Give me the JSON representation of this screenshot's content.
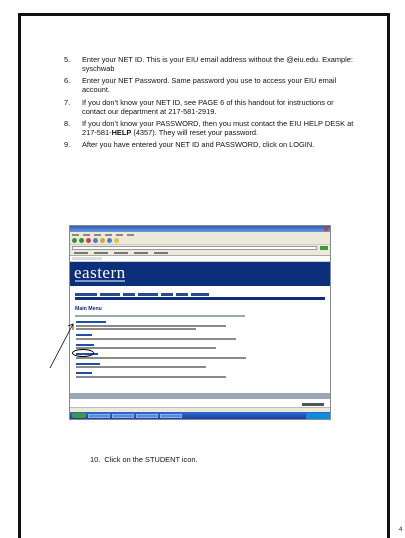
{
  "steps": [
    {
      "num": "5.",
      "text": "Enter your NET ID.  This is your EIU email address without the @eiu.edu.  Example:  syschwab"
    },
    {
      "num": "6.",
      "text": "Enter your NET Password. Same password you use to access your EIU email account."
    },
    {
      "num": "7.",
      "text": "If you don’t know your NET ID, see PAGE 6 of this handout for instructions or contact our department at 217-581-2919."
    },
    {
      "num": "8.",
      "text_before": "If you don’t know your PASSWORD, then you must contact the EIU HELP DESK at 217-581-",
      "text_bold": "HELP",
      "text_after": " (4357).  They will reset your password."
    },
    {
      "num": "9.",
      "text": "After you have entered your NET ID and PASSWORD, click on LOGIN."
    }
  ],
  "screenshot": {
    "logo": "eastern",
    "page_title": "Main Menu"
  },
  "step10": {
    "num": "10.",
    "text": "Click on the STUDENT icon."
  },
  "page_number": "4"
}
